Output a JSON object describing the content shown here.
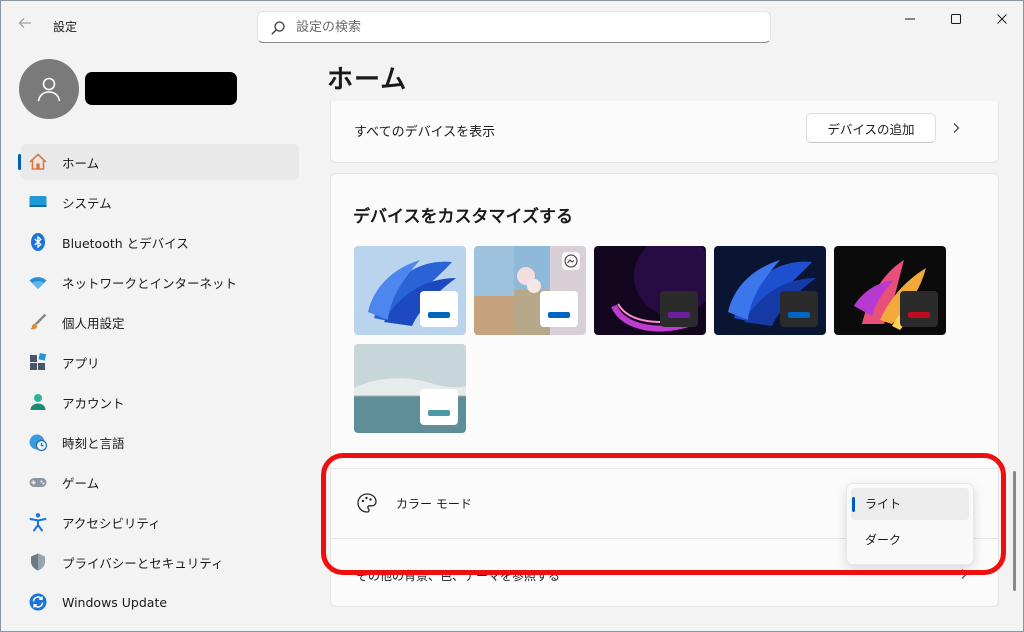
{
  "window": {
    "title": "設定"
  },
  "search": {
    "placeholder": "設定の検索"
  },
  "page": {
    "title": "ホーム"
  },
  "sidebar": {
    "items": [
      {
        "label": "ホーム",
        "icon": "home-icon",
        "active": true
      },
      {
        "label": "システム",
        "icon": "system-icon"
      },
      {
        "label": "Bluetooth とデバイス",
        "icon": "bluetooth-icon"
      },
      {
        "label": "ネットワークとインターネット",
        "icon": "wifi-icon"
      },
      {
        "label": "個人用設定",
        "icon": "brush-icon"
      },
      {
        "label": "アプリ",
        "icon": "apps-icon"
      },
      {
        "label": "アカウント",
        "icon": "account-icon"
      },
      {
        "label": "時刻と言語",
        "icon": "globe-clock-icon"
      },
      {
        "label": "ゲーム",
        "icon": "gamepad-icon"
      },
      {
        "label": "アクセシビリティ",
        "icon": "accessibility-icon"
      },
      {
        "label": "プライバシーとセキュリティ",
        "icon": "shield-icon"
      },
      {
        "label": "Windows Update",
        "icon": "update-icon"
      }
    ]
  },
  "devices": {
    "show_all_label": "すべてのデバイスを表示",
    "add_button": "デバイスの追加"
  },
  "customize": {
    "heading": "デバイスをカスタマイズする",
    "themes": [
      {
        "name": "windows-light",
        "accent": "#0067c0"
      },
      {
        "name": "captured-motion",
        "accent": "#0067c0"
      },
      {
        "name": "glow",
        "accent": "#6a1fa0"
      },
      {
        "name": "windows-dark",
        "accent": "#0067c0"
      },
      {
        "name": "flow",
        "accent": "#c00a1d"
      },
      {
        "name": "sunrise",
        "accent": "#4a98a8"
      }
    ],
    "color_mode_label": "カラー モード",
    "other_row_label": "その他の背景、色、テーマを参照する",
    "options": [
      "ライト",
      "ダーク"
    ],
    "selected_option": "ライト"
  },
  "colors": {
    "accent": "#005fb8",
    "highlight": "#ee1010"
  }
}
